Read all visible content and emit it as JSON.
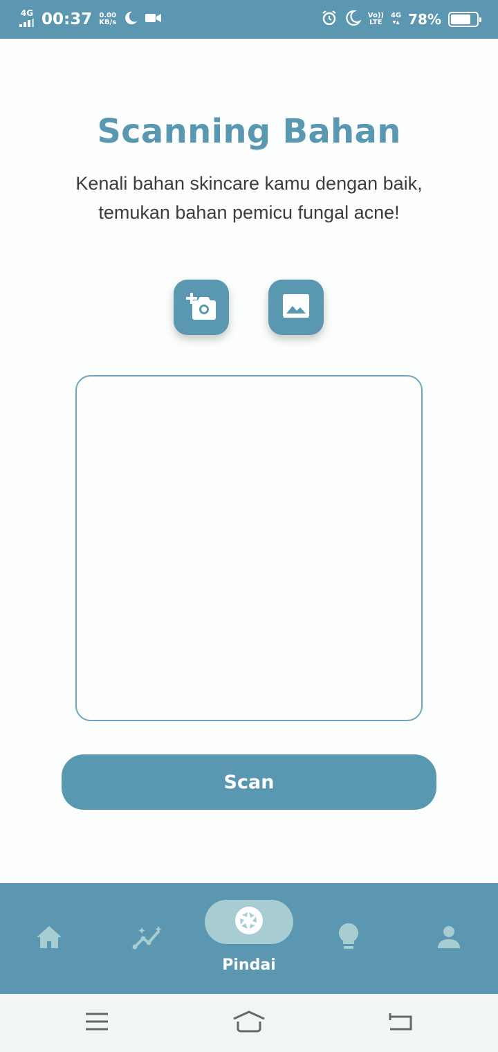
{
  "status_bar": {
    "network": "4G",
    "time": "00:37",
    "speed_value": "0.00",
    "speed_unit": "KB/s",
    "volte_top": "Vo))",
    "volte_bottom": "LTE",
    "network2": "4G",
    "battery_percent_text": "78%",
    "battery_level": 0.78
  },
  "main": {
    "title": "Scanning Bahan",
    "subtitle": "Kenali bahan skincare kamu dengan baik, temukan bahan pemicu fungal acne!",
    "camera_icon": "add-camera-icon",
    "gallery_icon": "image-gallery-icon",
    "scan_label": "Scan"
  },
  "bottom_nav": {
    "items": [
      {
        "icon": "home-icon"
      },
      {
        "icon": "progress-chart-icon"
      },
      {
        "icon": "camera-shutter-icon",
        "label": "Pindai",
        "active": true
      },
      {
        "icon": "lightbulb-icon"
      },
      {
        "icon": "person-icon"
      }
    ]
  },
  "colors": {
    "primary": "#5a98b1",
    "active_pill": "#a7cdd2",
    "background": "#fbfefc",
    "text": "#3d3d3d"
  }
}
